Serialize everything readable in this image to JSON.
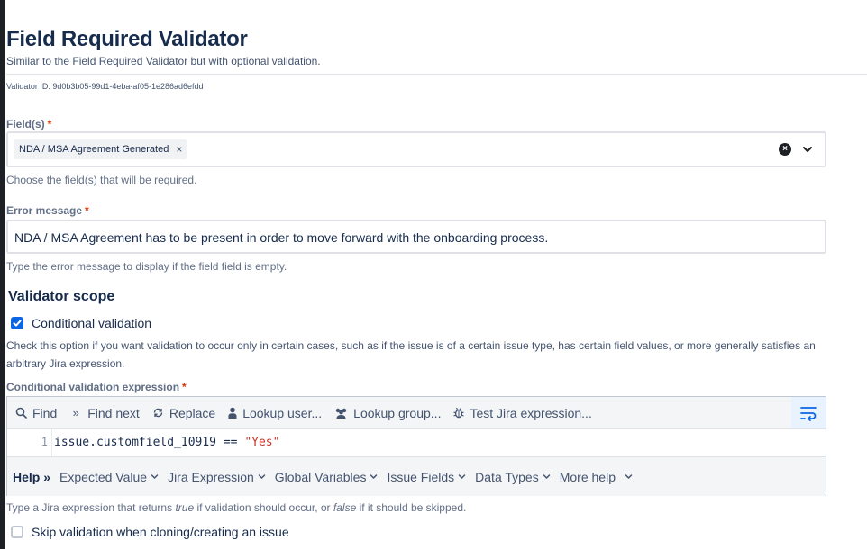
{
  "header": {
    "title": "Field Required Validator",
    "subtitle": "Similar to the Field Required Validator but with optional validation.",
    "validator_id": "Validator ID: 9d0b3b05-99d1-4eba-af05-1e286ad6efdd"
  },
  "fields": {
    "label": "Field(s)",
    "required_mark": "*",
    "selected_tag": "NDA / MSA Agreement Generated",
    "tag_remove": "×",
    "helper": "Choose the field(s) that will be required."
  },
  "error_message": {
    "label": "Error message",
    "required_mark": "*",
    "value": "NDA / MSA Agreement has to be present in order to move forward with the onboarding process.",
    "helper": "Type the error message to display if the field field is empty."
  },
  "scope": {
    "title": "Validator scope",
    "conditional_label": "Conditional validation",
    "conditional_checked": true,
    "description": "Check this option if you want validation to occur only in certain cases, such as if the issue is of a certain issue type, has certain field values, or more generally satisfies an arbitrary Jira expression."
  },
  "expression": {
    "label": "Conditional validation expression",
    "required_mark": "*",
    "toolbar": {
      "find": "Find",
      "find_next": "Find next",
      "replace": "Replace",
      "lookup_user": "Lookup user...",
      "lookup_group": "Lookup group...",
      "test_expression": "Test Jira expression..."
    },
    "line_number": "1",
    "code_prefix": "issue.customfield_10919 == ",
    "code_string": "\"Yes\"",
    "help": {
      "label": "Help",
      "items": [
        "Expected Value",
        "Jira Expression",
        "Global Variables",
        "Issue Fields",
        "Data Types",
        "More help"
      ]
    },
    "footer_prefix": "Type a Jira expression that returns ",
    "footer_true": "true",
    "footer_middle": " if validation should occur, or ",
    "footer_false": "false",
    "footer_suffix": " if it should be skipped."
  },
  "skip": {
    "label": "Skip validation when cloning/creating an issue",
    "checked": false
  },
  "colors": {
    "accent": "#0c66e4",
    "required": "#de350b",
    "string_literal": "#c9372c"
  }
}
